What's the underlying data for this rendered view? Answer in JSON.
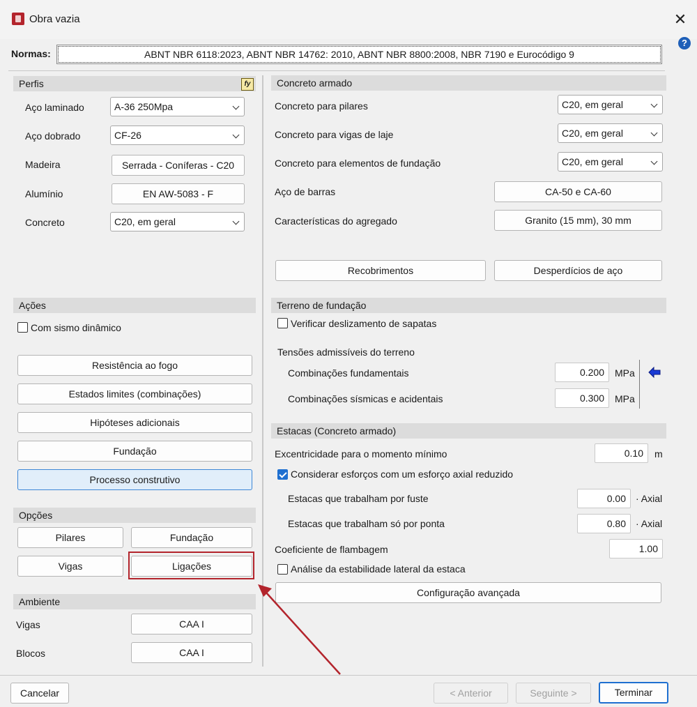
{
  "window": {
    "title": "Obra vazia"
  },
  "normas": {
    "label": "Normas:",
    "value": "ABNT NBR 6118:2023, ABNT NBR 14762: 2010, ABNT NBR 8800:2008, NBR 7190 e Eurocódigo 9"
  },
  "perfis": {
    "header": "Perfis",
    "fy_icon": "fy",
    "rows": [
      {
        "label": "Aço laminado",
        "value": "A-36 250Mpa"
      },
      {
        "label": "Aço dobrado",
        "value": "CF-26"
      },
      {
        "label": "Madeira",
        "value": "Serrada - Coníferas - C20"
      },
      {
        "label": "Alumínio",
        "value": "EN AW-5083 - F"
      },
      {
        "label": "Concreto",
        "value": "C20, em geral"
      }
    ]
  },
  "acoes": {
    "header": "Ações",
    "sismo_label": "Com sismo dinâmico",
    "buttons": [
      "Resistência ao fogo",
      "Estados limites (combinações)",
      "Hipóteses adicionais",
      "Fundação",
      "Processo construtivo"
    ]
  },
  "opcoes": {
    "header": "Opções",
    "buttons": [
      "Pilares",
      "Fundação",
      "Vigas",
      "Ligações"
    ]
  },
  "ambiente": {
    "header": "Ambiente",
    "rows": [
      {
        "label": "Vigas",
        "value": "CAA I"
      },
      {
        "label": "Blocos",
        "value": "CAA I"
      }
    ]
  },
  "concreto": {
    "header": "Concreto armado",
    "rows": [
      {
        "label": "Concreto para pilares",
        "value": "C20, em geral"
      },
      {
        "label": "Concreto para vigas de laje",
        "value": "C20, em geral"
      },
      {
        "label": "Concreto para elementos de fundação",
        "value": "C20, em geral"
      },
      {
        "label": "Aço de barras",
        "value": "CA-50 e CA-60"
      },
      {
        "label": "Características do agregado",
        "value": "Granito (15 mm), 30 mm"
      }
    ],
    "recobrimentos": "Recobrimentos",
    "desperdicios": "Desperdícios de aço"
  },
  "terreno": {
    "header": "Terreno de fundação",
    "deslizamento_label": "Verificar deslizamento de sapatas",
    "tensoes_label": "Tensões admissíveis do terreno",
    "fundamentais_label": "Combinações fundamentais",
    "fundamentais_value": "0.200",
    "sismicas_label": "Combinações sísmicas e acidentais",
    "sismicas_value": "0.300",
    "unit": "MPa",
    "arrow_icon": "arrow-left-icon"
  },
  "estacas": {
    "header": "Estacas (Concreto armado)",
    "excentricidade_label": "Excentricidade para o momento mínimo",
    "excentricidade_value": "0.10",
    "excentricidade_unit": "m",
    "reduzido_label": "Considerar esforços com um esforço axial reduzido",
    "fuste_label": "Estacas que trabalham por fuste",
    "fuste_value": "0.00",
    "ponta_label": "Estacas que trabalham só por ponta",
    "ponta_value": "0.80",
    "axial_unit": "· Axial",
    "flambagem_label": "Coeficiente de flambagem",
    "flambagem_value": "1.00",
    "estabilidade_label": "Análise da estabilidade lateral da estaca",
    "config_button": "Configuração avançada"
  },
  "footer": {
    "cancel": "Cancelar",
    "prev": "< Anterior",
    "next": "Seguinte >",
    "finish": "Terminar"
  },
  "colors": {
    "accent": "#1e6fd0",
    "annotation": "#b3242c"
  }
}
